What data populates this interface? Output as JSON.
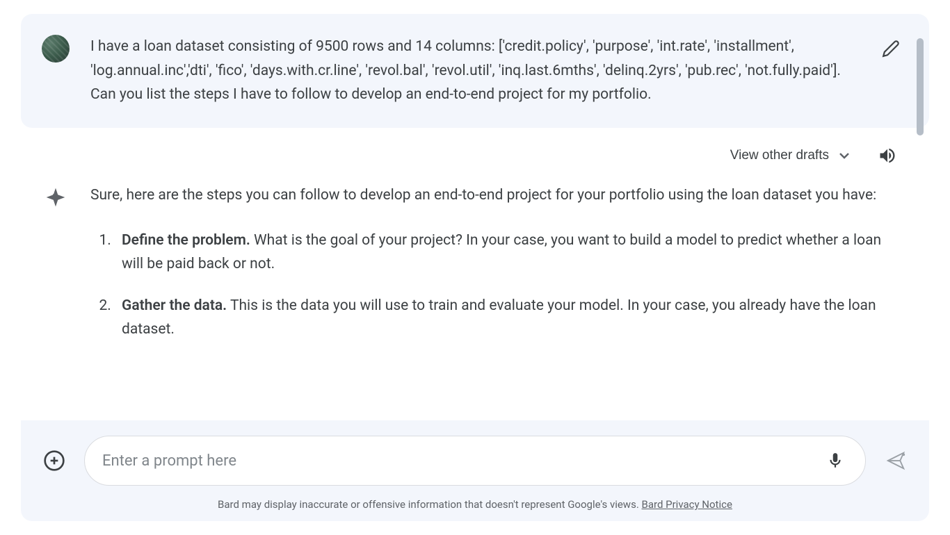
{
  "user_message": "I have a loan dataset consisting of 9500 rows and 14 columns: ['credit.policy', 'purpose', 'int.rate', 'installment', 'log.annual.inc','dti', 'fico', 'days.with.cr.line', 'revol.bal', 'revol.util', 'inq.last.6mths', 'delinq.2yrs', 'pub.rec', 'not.fully.paid']. Can you list the steps I have to follow to develop an end-to-end project for my portfolio.",
  "response": {
    "view_drafts_label": "View other drafts",
    "intro": "Sure, here are the steps you can follow to develop an end-to-end project for your portfolio using the loan dataset you have:",
    "steps": [
      {
        "title": "Define the problem.",
        "body": " What is the goal of your project? In your case, you want to build a model to predict whether a loan will be paid back or not."
      },
      {
        "title": "Gather the data.",
        "body": " This is the data you will use to train and evaluate your model. In your case, you already have the loan dataset."
      }
    ]
  },
  "input": {
    "placeholder": "Enter a prompt here"
  },
  "disclaimer": {
    "text": "Bard may display inaccurate or offensive information that doesn't represent Google's views. ",
    "link_text": "Bard Privacy Notice"
  }
}
